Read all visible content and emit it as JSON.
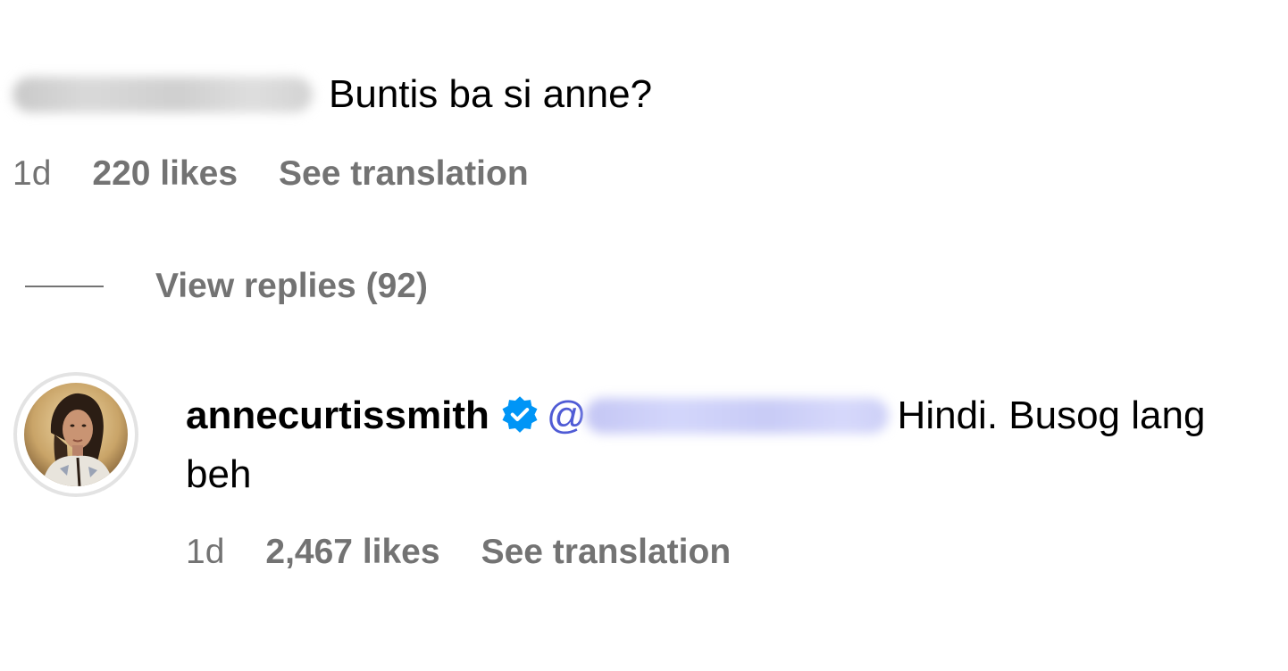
{
  "comment": {
    "text": "Buntis ba si anne?",
    "time": "1d",
    "likes": "220 likes",
    "translate": "See translation"
  },
  "replies_toggle": {
    "label": "View replies (92)"
  },
  "reply": {
    "username": "annecurtissmith",
    "mention_prefix": "@",
    "text": "Hindi. Busog lang beh",
    "time": "1d",
    "likes": "2,467 likes",
    "translate": "See translation"
  },
  "colors": {
    "meta_gray": "#737373",
    "verified_blue": "#0095f6",
    "mention_purple": "#4f5bd5"
  },
  "icons": {
    "verified": "verified-badge-icon",
    "avatar": "profile-avatar"
  }
}
